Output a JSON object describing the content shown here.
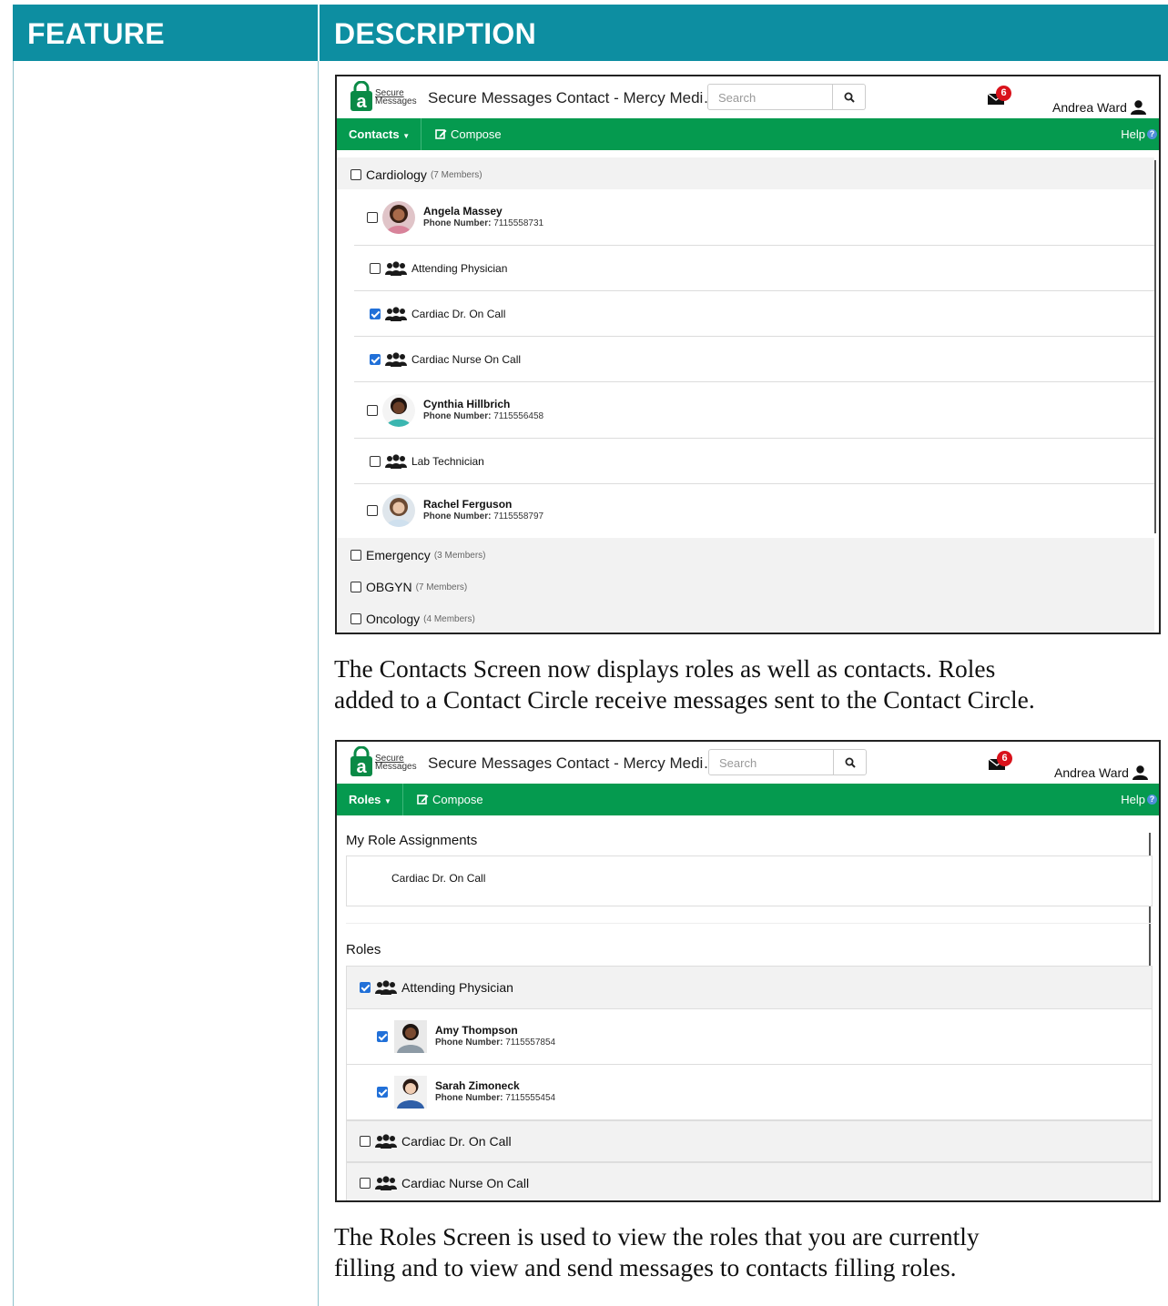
{
  "table": {
    "col_feature": "FEATURE",
    "col_description": "DESCRIPTION"
  },
  "colors": {
    "header_bg": "#0d8ea1",
    "nav_bg": "#059a4f",
    "badge": "#d9121b",
    "checkbox_checked": "#2170d8"
  },
  "contacts_screen": {
    "logo_line1": "Secure",
    "logo_line2": "Messages",
    "title": "Secure Messages Contact - Mercy Medi…",
    "search_placeholder": "Search",
    "mail_badge": "6",
    "user_name": "Andrea Ward",
    "nav_dropdown": "Contacts",
    "nav_compose": "Compose",
    "nav_help": "Help",
    "phone_label": "Phone Number:",
    "groups": [
      {
        "name": "Cardiology",
        "members": "(7 Members)",
        "checked": false
      },
      {
        "name": "Emergency",
        "members": "(3 Members)",
        "checked": false
      },
      {
        "name": "OBGYN",
        "members": "(7 Members)",
        "checked": false
      },
      {
        "name": "Oncology",
        "members": "(4 Members)",
        "checked": false
      }
    ],
    "items": [
      {
        "type": "person",
        "name": "Angela Massey",
        "phone": "7115558731",
        "checked": false
      },
      {
        "type": "role",
        "name": "Attending Physician",
        "checked": false
      },
      {
        "type": "role",
        "name": "Cardiac Dr. On Call",
        "checked": true
      },
      {
        "type": "role",
        "name": "Cardiac Nurse On Call",
        "checked": true
      },
      {
        "type": "person",
        "name": "Cynthia Hillbrich",
        "phone": "7115556458",
        "checked": false
      },
      {
        "type": "role",
        "name": "Lab Technician",
        "checked": false
      },
      {
        "type": "person",
        "name": "Rachel Ferguson",
        "phone": "7115558797",
        "checked": false
      }
    ]
  },
  "caption1": {
    "line1": "The Contacts Screen now displays roles as well as contacts. Roles",
    "line2": "added to a Contact Circle receive messages sent to the Contact Circle."
  },
  "roles_screen": {
    "logo_line1": "Secure",
    "logo_line2": "Messages",
    "title": "Secure Messages Contact - Mercy Medi…",
    "search_placeholder": "Search",
    "mail_badge": "6",
    "user_name": "Andrea Ward",
    "nav_dropdown": "Roles",
    "nav_compose": "Compose",
    "nav_help": "Help",
    "my_assignments_label": "My Role Assignments",
    "my_assignment": "Cardiac Dr. On Call",
    "roles_label": "Roles",
    "phone_label": "Phone Number:",
    "roles": [
      {
        "name": "Attending Physician",
        "checked": true
      },
      {
        "name": "Cardiac Dr. On Call",
        "checked": false
      },
      {
        "name": "Cardiac Nurse On Call",
        "checked": false
      }
    ],
    "role_members": [
      {
        "name": "Amy Thompson",
        "phone": "7115557854",
        "checked": true
      },
      {
        "name": "Sarah Zimoneck",
        "phone": "7115555454",
        "checked": true
      }
    ]
  },
  "caption2": {
    "line1": "The Roles Screen is used to view the roles that you are currently",
    "line2": "filling and to view and send messages to contacts filling roles."
  }
}
